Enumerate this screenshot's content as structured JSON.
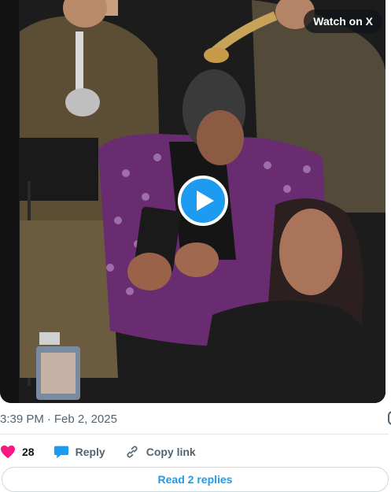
{
  "video": {
    "watch_label": "Watch on X",
    "play_icon": "play-icon"
  },
  "meta": {
    "time": "3:39 PM",
    "separator": "·",
    "date": "Feb 2, 2025"
  },
  "actions": {
    "likes_count": "28",
    "reply_label": "Reply",
    "copy_link_label": "Copy link",
    "like_color": "#f91880",
    "reply_color": "#1d9bf0"
  },
  "replies": {
    "read_label": "Read 2 replies"
  }
}
